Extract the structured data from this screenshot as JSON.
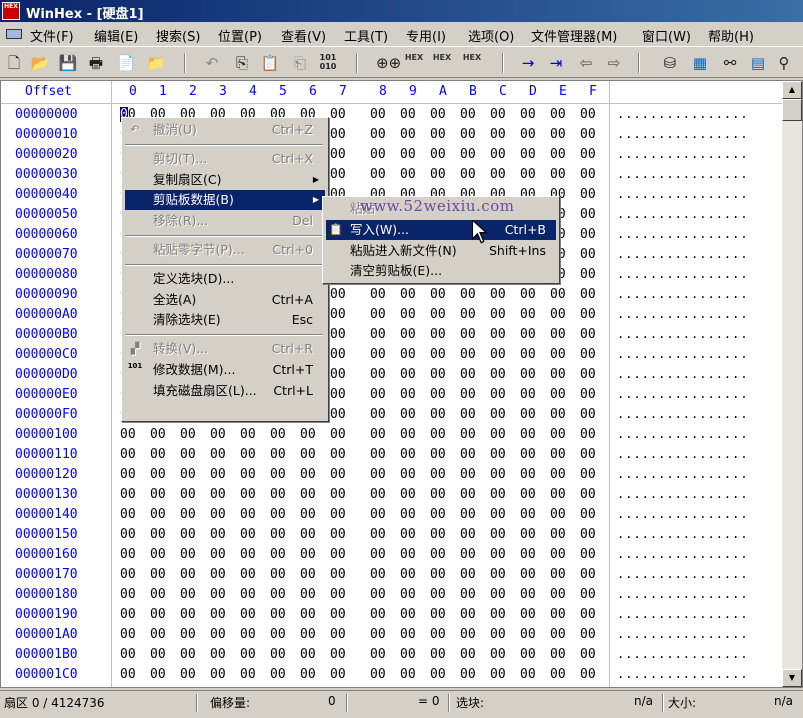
{
  "window": {
    "title": "WinHex - [硬盘1]",
    "app_icon": "HEX"
  },
  "menubar": {
    "items": [
      "文件(F)",
      "编辑(E)",
      "搜索(S)",
      "位置(P)",
      "查看(V)",
      "工具(T)",
      "专用(I)",
      "选项(O)",
      "文件管理器(M)",
      "窗口(W)",
      "帮助(H)"
    ]
  },
  "toolbar": {
    "txt_icons": [
      "101\n010",
      "HEX",
      "HEX",
      "HEX"
    ]
  },
  "hex": {
    "header_offset": "Offset",
    "columns": [
      "0",
      "1",
      "2",
      "3",
      "4",
      "5",
      "6",
      "7",
      "8",
      "9",
      "A",
      "B",
      "C",
      "D",
      "E",
      "F"
    ],
    "offsets": [
      "00000000",
      "00000010",
      "00000020",
      "00000030",
      "00000040",
      "00000050",
      "00000060",
      "00000070",
      "00000080",
      "00000090",
      "000000A0",
      "000000B0",
      "000000C0",
      "000000D0",
      "000000E0",
      "000000F0",
      "00000100",
      "00000110",
      "00000120",
      "00000130",
      "00000140",
      "00000150",
      "00000160",
      "00000170",
      "00000180",
      "00000190",
      "000001A0",
      "000001B0",
      "000001C0"
    ],
    "byte": "00",
    "cursor_char": "0",
    "ascii_row": "................"
  },
  "context_menu": {
    "items": [
      {
        "label": "撤消(U)",
        "shortcut": "Ctrl+Z",
        "disabled": true,
        "icon": "undo-icon",
        "glyph": "↶"
      },
      {
        "sep": true
      },
      {
        "label": "剪切(T)...",
        "shortcut": "Ctrl+X",
        "disabled": true
      },
      {
        "label": "复制扇区(C)",
        "shortcut": "",
        "disabled": false,
        "submenu": true
      },
      {
        "label": "剪贴板数据(B)",
        "shortcut": "",
        "disabled": false,
        "submenu": true,
        "highlight": true
      },
      {
        "label": "移除(R)...",
        "shortcut": "Del",
        "disabled": true
      },
      {
        "sep": true
      },
      {
        "label": "粘贴零字节(P)...",
        "shortcut": "Ctrl+0",
        "disabled": true
      },
      {
        "sep": true
      },
      {
        "label": "定义选块(D)...",
        "shortcut": "",
        "disabled": false
      },
      {
        "label": "全选(A)",
        "shortcut": "Ctrl+A",
        "disabled": false
      },
      {
        "label": "清除选块(E)",
        "shortcut": "Esc",
        "disabled": false
      },
      {
        "sep": true
      },
      {
        "label": "转换(V)...",
        "shortcut": "Ctrl+R",
        "disabled": true,
        "icon": "convert-icon",
        "glyph": "▞"
      },
      {
        "label": "修改数据(M)...",
        "shortcut": "Ctrl+T",
        "disabled": false,
        "icon": "modify-data-icon",
        "glyph": "101"
      },
      {
        "label": "填充磁盘扇区(L)...",
        "shortcut": "Ctrl+L",
        "disabled": false
      }
    ]
  },
  "submenu": {
    "items": [
      {
        "label": "粘贴",
        "shortcut": "",
        "disabled": true
      },
      {
        "label": "写入(W)...",
        "shortcut": "Ctrl+B",
        "disabled": false,
        "highlight": true,
        "icon": "clipboard-icon",
        "glyph": "📋"
      },
      {
        "label": "粘贴进入新文件(N)",
        "shortcut": "Shift+Ins",
        "disabled": false
      },
      {
        "label": "清空剪贴板(E)...",
        "shortcut": "",
        "disabled": false
      }
    ]
  },
  "watermark": "www.52weixiu.com",
  "status": {
    "sector": "扇区 0 / 4124736",
    "offset_label": "偏移量:",
    "offset_value": "0",
    "eq": "= 0",
    "block_label": "选块:",
    "na1": "n/a",
    "size_label": "大小:",
    "na2": "n/a"
  }
}
